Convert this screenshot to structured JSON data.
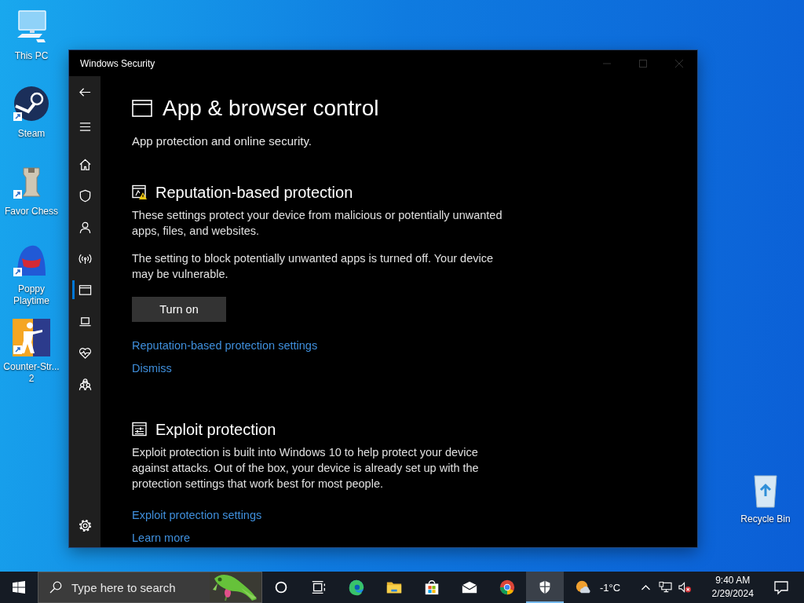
{
  "desktop_icons": [
    {
      "label": "This PC",
      "kind": "pc"
    },
    {
      "label": "Steam",
      "kind": "steam"
    },
    {
      "label": "Favor Chess",
      "kind": "chess"
    },
    {
      "label": "Poppy Playtime",
      "kind": "poppy"
    },
    {
      "label": "Counter-Str... 2",
      "kind": "cs"
    }
  ],
  "recycle_bin": {
    "label": "Recycle Bin"
  },
  "window": {
    "title": "Windows Security"
  },
  "nav": [
    {
      "kind": "home",
      "selected": false
    },
    {
      "kind": "shield",
      "selected": false
    },
    {
      "kind": "account",
      "selected": false
    },
    {
      "kind": "network",
      "selected": false
    },
    {
      "kind": "browser",
      "selected": true
    },
    {
      "kind": "device",
      "selected": false
    },
    {
      "kind": "health",
      "selected": false
    },
    {
      "kind": "family",
      "selected": false
    }
  ],
  "page": {
    "title": "App & browser control",
    "subtitle": "App protection and online security.",
    "sections": [
      {
        "kind": "reputation",
        "title": "Reputation-based protection",
        "paragraphs": [
          "These settings protect your device from malicious or potentially unwanted apps, files, and websites.",
          "The setting to block potentially unwanted apps is turned off. Your device may be vulnerable."
        ],
        "button": "Turn on",
        "links": [
          "Reputation-based protection settings",
          "Dismiss"
        ]
      },
      {
        "kind": "exploit",
        "title": "Exploit protection",
        "paragraphs": [
          "Exploit protection is built into Windows 10 to help protect your device against attacks.  Out of the box, your device is already set up with the protection settings that work best for most people."
        ],
        "links": [
          "Exploit protection settings",
          "Learn more"
        ]
      }
    ]
  },
  "taskbar": {
    "search": {
      "placeholder": "Type here to search"
    },
    "apps": [
      {
        "kind": "cortana",
        "selected": false
      },
      {
        "kind": "taskview",
        "selected": false
      },
      {
        "kind": "edge",
        "selected": false
      },
      {
        "kind": "explorer",
        "selected": false
      },
      {
        "kind": "store",
        "selected": false
      },
      {
        "kind": "mail",
        "selected": false
      },
      {
        "kind": "chrome",
        "selected": false
      },
      {
        "kind": "security",
        "selected": true
      }
    ],
    "weather": "-1°C",
    "time": "9:40 AM",
    "date": "2/29/2024"
  }
}
